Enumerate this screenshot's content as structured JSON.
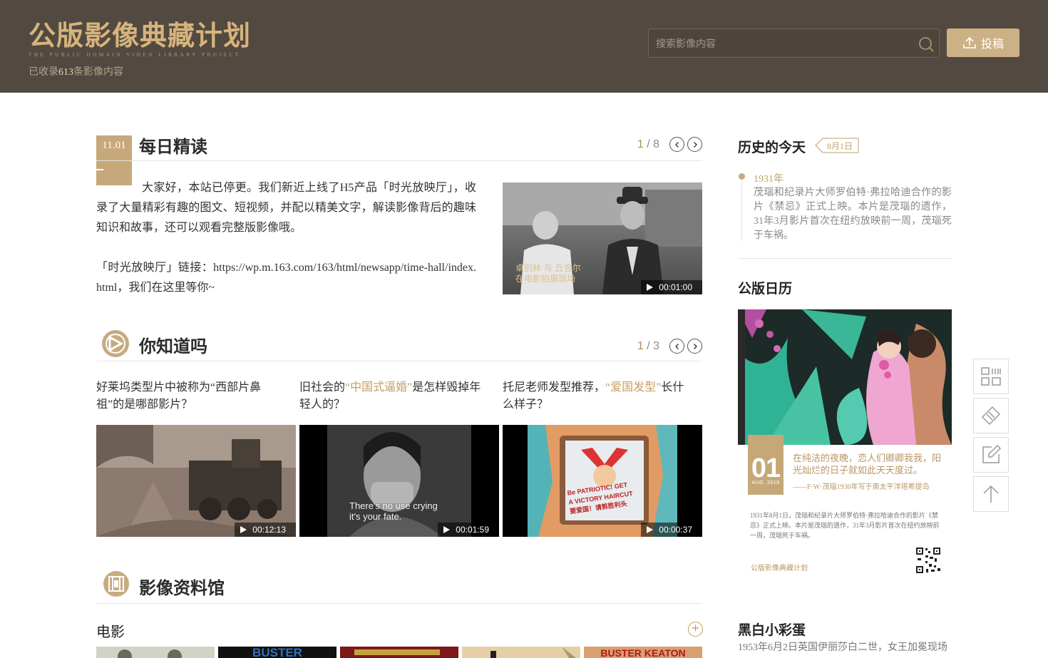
{
  "header": {
    "logo_cn": "公版影像典藏计划",
    "logo_en": "THE PUBLIC DOMAIN VIDEO LIBRARY PROJECT",
    "count_prefix": "已收录",
    "count_value": "613",
    "count_suffix": "条影像内容",
    "search_placeholder": "搜索影像内容",
    "submit_label": "投稿"
  },
  "daily": {
    "title": "每日精读",
    "date": "11.01",
    "page_current": "1",
    "page_sep": "/",
    "page_total": "8",
    "paragraph": "大家好，本站已停更。我们新近上线了H5产品「时光放映厅」，收录了大量精彩有趣的图文、短视频，并配以精美文字，解读影像背后的趣味知识和故事，还可以观看完整版影像哦。",
    "link_line": "「时光放映厅」链接：https://wp.m.163.com/163/html/newsapp/time-hall/index.html，我们在这里等你~",
    "video": {
      "caption_1": "卓别林 与 丘吉尔",
      "caption_2": "在电影拍摄现场",
      "duration": "00:01:00"
    }
  },
  "know": {
    "title": "你知道吗",
    "page_current": "1",
    "page_sep": "/",
    "page_total": "3",
    "items": [
      {
        "text": "好莱坞类型片中被称为“西部片鼻祖”的是哪部影片？",
        "duration": "00:12:13"
      },
      {
        "pre": "旧社会的",
        "hl": "“中国式逼婚”",
        "post": "是怎样毁掉年轻人的？",
        "duration": "00:01:59",
        "subtitle_1": "There's no use crying",
        "subtitle_2": "it's your fate."
      },
      {
        "pre": "托尼老师发型推荐，",
        "hl": "“爱国发型”",
        "post": "长什么样子？",
        "duration": "00:00:37",
        "poster_1": "Be PATRIOTIC! GET",
        "poster_2": "A VICTORY HAIRCUT",
        "poster_3": "要爱国！请剪胜利头"
      }
    ]
  },
  "archive": {
    "title": "影像资料馆",
    "category": "电影",
    "more": "+",
    "thumbs": [
      "BUSTER",
      "BUSTER KEATON"
    ]
  },
  "history": {
    "title": "历史的今天",
    "date": "8月1日",
    "year": "1931年",
    "desc": "茂瑙和纪录片大师罗伯特·弗拉哈迪合作的影片《禁忌》正式上映。本片是茂瑙的遗作，31年3月影片首次在纽约放映前一周，茂瑙死于车祸。"
  },
  "calendar": {
    "title": "公版日历",
    "day": "01",
    "month": "AUG. 2019",
    "quote": "在纯洁的夜晚，恋人们卿卿我我，阳光灿烂的日子就如此天天度过。",
    "attribution": "——F·W·茂瑙1930年写于南太平洋塔希提岛",
    "small_text": "1931年8月1日，茂瑙和纪录片大师罗伯特·弗拉哈迪合作的影片《禁忌》正式上映。本片是茂瑙的遗作，31年3月影片首次在纽约放映前一周，茂瑙死于车祸。",
    "brand": "公版影像典藏计划"
  },
  "easter": {
    "title": "黑白小彩蛋",
    "text": "1953年6月2日英国伊丽莎白二世，女王加冕现场"
  },
  "colors": {
    "header_bg": "#524a41",
    "gold": "#d7b47c",
    "accent": "#c6ab81"
  }
}
